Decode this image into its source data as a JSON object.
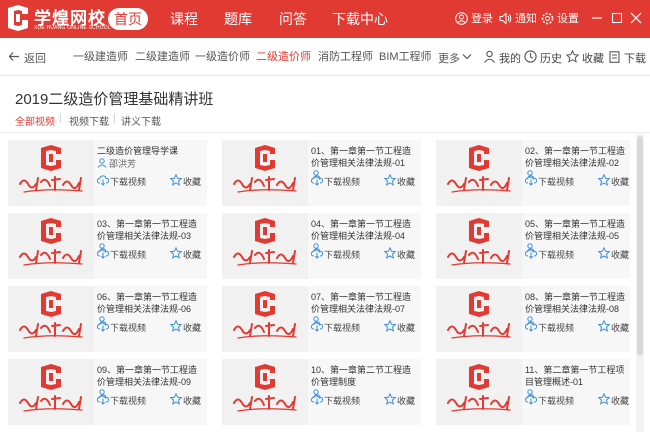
{
  "brand": {
    "name": "学煌网校",
    "subtitle": "XUE HUANG ONLINE SCHOOL",
    "accent": "#e03a33"
  },
  "main_nav": [
    {
      "label": "首页",
      "active": true
    },
    {
      "label": "课程",
      "active": false
    },
    {
      "label": "题库",
      "active": false
    },
    {
      "label": "问答",
      "active": false
    },
    {
      "label": "下载中心",
      "active": false
    }
  ],
  "top_right": {
    "login": "登录",
    "notice": "通知",
    "settings": "设置"
  },
  "back_label": "返回",
  "categories": [
    {
      "label": "一级建造师",
      "active": false
    },
    {
      "label": "二级建造师",
      "active": false
    },
    {
      "label": "一级造价师",
      "active": false
    },
    {
      "label": "二级造价师",
      "active": true
    },
    {
      "label": "消防工程师",
      "active": false
    },
    {
      "label": "BIM工程师",
      "active": false
    }
  ],
  "more_label": "更多",
  "user_links": {
    "mine": "我的",
    "history": "历史",
    "favorites": "收藏",
    "downloads": "下载"
  },
  "page_title": "2019二级造价管理基础精讲班",
  "filters": [
    {
      "label": "全部视频",
      "active": true
    },
    {
      "label": "视频下载",
      "active": false
    },
    {
      "label": "讲义下载",
      "active": false
    }
  ],
  "card_actions": {
    "download": "下载视频",
    "favorite": "收藏"
  },
  "videos": [
    {
      "title": "二级造价管理导学课",
      "teacher": "邵洪芳"
    },
    {
      "title": "01、第一章第一节工程造价管理相关法律法规-01",
      "teacher": ""
    },
    {
      "title": "02、第一章第一节工程造价管理相关法律法规-02",
      "teacher": ""
    },
    {
      "title": "03、第一章第一节工程造价管理相关法律法规-03",
      "teacher": ""
    },
    {
      "title": "04、第一章第一节工程造价管理相关法律法规-04",
      "teacher": ""
    },
    {
      "title": "05、第一章第一节工程造价管理相关法律法规-05",
      "teacher": ""
    },
    {
      "title": "06、第一章第一节工程造价管理相关法律法规-06",
      "teacher": ""
    },
    {
      "title": "07、第一章第一节工程造价管理相关法律法规-07",
      "teacher": ""
    },
    {
      "title": "08、第一章第一节工程造价管理相关法律法规-08",
      "teacher": ""
    },
    {
      "title": "09、第一章第一节工程造价管理相关法律法规-09",
      "teacher": ""
    },
    {
      "title": "10、第一章第二节工程造价管理制度",
      "teacher": ""
    },
    {
      "title": "11、第二章第一节工程项目管理概述-01",
      "teacher": ""
    }
  ]
}
